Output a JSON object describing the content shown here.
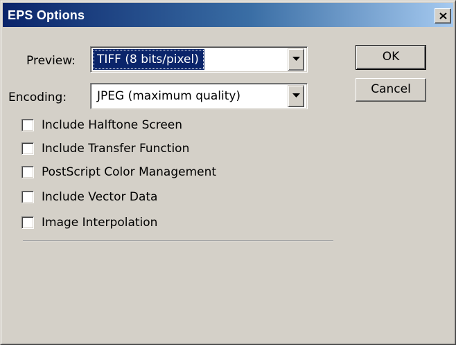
{
  "window": {
    "title": "EPS Options"
  },
  "preview": {
    "label": "Preview:",
    "selected": "TIFF  (8 bits/pixel)"
  },
  "encoding": {
    "label": "Encoding:",
    "selected": "JPEG  (maximum quality)"
  },
  "buttons": {
    "ok": "OK",
    "cancel": "Cancel"
  },
  "options": [
    {
      "label": "Include Halftone Screen",
      "checked": false
    },
    {
      "label": "Include Transfer Function",
      "checked": false
    },
    {
      "label": "PostScript Color Management",
      "checked": false
    },
    {
      "label": "Include Vector Data",
      "checked": false
    },
    {
      "label": "Image Interpolation",
      "checked": false
    }
  ],
  "icons": {
    "close": "close-icon",
    "dropdown": "chevron-down-icon"
  },
  "colors": {
    "face": "#d4d0c8",
    "title_start": "#0a246a",
    "title_end": "#a6caf0",
    "selection": "#0a246a"
  }
}
